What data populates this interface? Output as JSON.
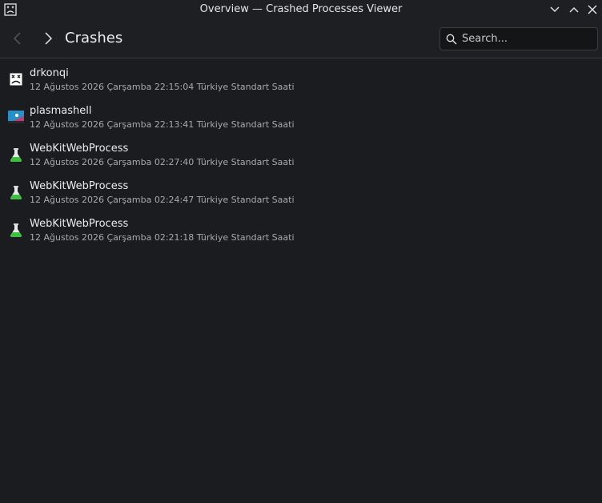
{
  "window": {
    "title": "Overview — Crashed Processes Viewer"
  },
  "header": {
    "title": "Crashes",
    "search_placeholder": "Search..."
  },
  "crashes": [
    {
      "name": "drkonqi",
      "date": "12 Ağustos 2026 Çarşamba 22:15:04 Türkiye Standart Saati",
      "icon": "drkonqi-icon"
    },
    {
      "name": "plasmashell",
      "date": "12 Ağustos 2026 Çarşamba 22:13:41 Türkiye Standart Saati",
      "icon": "plasmashell-icon"
    },
    {
      "name": "WebKitWebProcess",
      "date": "12 Ağustos 2026 Çarşamba 02:27:40 Türkiye Standart Saati",
      "icon": "flask-icon"
    },
    {
      "name": "WebKitWebProcess",
      "date": "12 Ağustos 2026 Çarşamba 02:24:47 Türkiye Standart Saati",
      "icon": "flask-icon"
    },
    {
      "name": "WebKitWebProcess",
      "date": "12 Ağustos 2026 Çarşamba 02:21:18 Türkiye Standart Saati",
      "icon": "flask-icon"
    }
  ],
  "colors": {
    "background": "#1b1c20",
    "header": "#1e1f23",
    "text": "#ececec",
    "subtext": "#a8a9ad",
    "flask_green": "#3fbf3f"
  }
}
